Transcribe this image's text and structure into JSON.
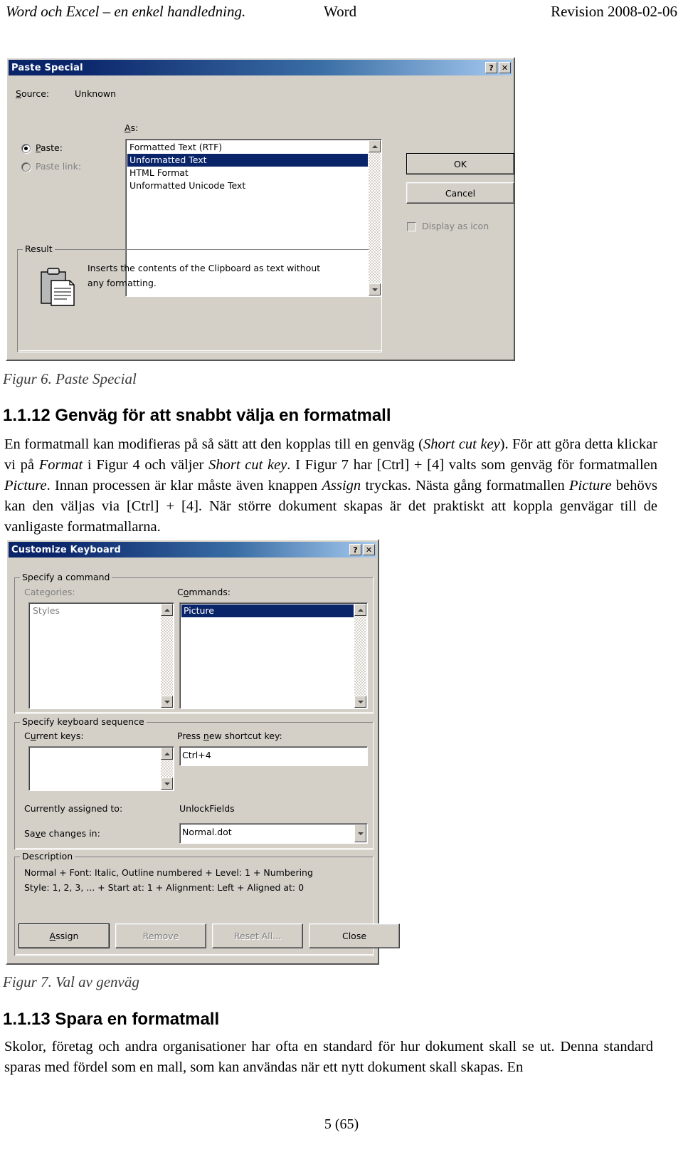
{
  "header": {
    "left": "Word och Excel – en enkel handledning.",
    "center": "Word",
    "right": "Revision 2008-02-06"
  },
  "paste_special_dialog": {
    "title": "Paste Special",
    "help_button": "?",
    "close_button": "✕",
    "source_label": "Source:",
    "source_value": "Unknown",
    "as_label": "As:",
    "paste_radio_label": "Paste:",
    "paste_link_radio_label": "Paste link:",
    "format_list": [
      "Formatted Text (RTF)",
      "Unformatted Text",
      "HTML Format",
      "Unformatted Unicode Text"
    ],
    "selected_format": "Unformatted Text",
    "ok_button": "OK",
    "cancel_button": "Cancel",
    "display_as_icon_label": "Display as icon",
    "result_group_label": "Result",
    "result_icon": "clipboard-icon",
    "result_text_line1": "Inserts the contents of the Clipboard as text without",
    "result_text_line2": "any formatting."
  },
  "figure6_caption": "Figur 6. Paste Special",
  "section_1_1_12": {
    "heading": "1.1.12 Genväg för att snabbt välja en formatmall",
    "paragraph_html": "En formatmall kan modifieras på så sätt att den kopplas till en genväg (<i>Short cut key</i>). För att göra detta klickar vi på <i>Format</i> i Figur 4 och väljer <i>Short cut key</i>. I Figur 7 har [Ctrl] + [4] valts som genväg för formatmallen <i>Picture</i>. Innan processen är klar måste även knappen <i>Assign</i> tryckas. Nästa gång formatmallen <i>Picture</i> behövs kan den väljas via  [Ctrl] + [4]. När större dokument skapas är det praktiskt att koppla genvägar till de vanligaste formatmallarna."
  },
  "customize_keyboard_dialog": {
    "title": "Customize Keyboard",
    "help_button": "?",
    "close_button": "✕",
    "specify_command_group": "Specify a command",
    "categories_label": "Categories:",
    "categories_items": [
      "Styles"
    ],
    "commands_label": "Commands:",
    "commands_items": [
      "Picture"
    ],
    "selected_command": "Picture",
    "specify_keyboard_group": "Specify keyboard sequence",
    "current_keys_label": "Current keys:",
    "current_keys_items": [],
    "press_new_shortcut_label": "Press new shortcut key:",
    "press_new_shortcut_value": "Ctrl+4",
    "currently_assigned_label": "Currently assigned to:",
    "currently_assigned_value": "UnlockFields",
    "save_changes_label": "Save changes in:",
    "save_changes_value": "Normal.dot",
    "description_group": "Description",
    "description_line1": "Normal + Font: Italic, Outline numbered + Level: 1 + Numbering",
    "description_line2": "Style: 1, 2, 3, ... + Start at: 1 + Alignment: Left + Aligned at:  0",
    "assign_button": "Assign",
    "remove_button": "Remove",
    "reset_all_button": "Reset All...",
    "close_dialog_button": "Close"
  },
  "figure7_caption": "Figur 7. Val av genväg",
  "section_1_1_13": {
    "heading": "1.1.13 Spara en formatmall",
    "paragraph": "Skolor, företag och andra organisationer har ofta en standard för hur dokument skall se ut. Denna standard sparas med fördel som en mall, som kan användas när ett nytt dokument skall skapas. En"
  },
  "page_number": "5 (65)",
  "colors": {
    "titlebar_start": "#0a246a",
    "titlebar_end": "#a6caf0",
    "dialog_face": "#d4d0c8",
    "selection": "#0a246a",
    "disabled_text": "#808080"
  }
}
